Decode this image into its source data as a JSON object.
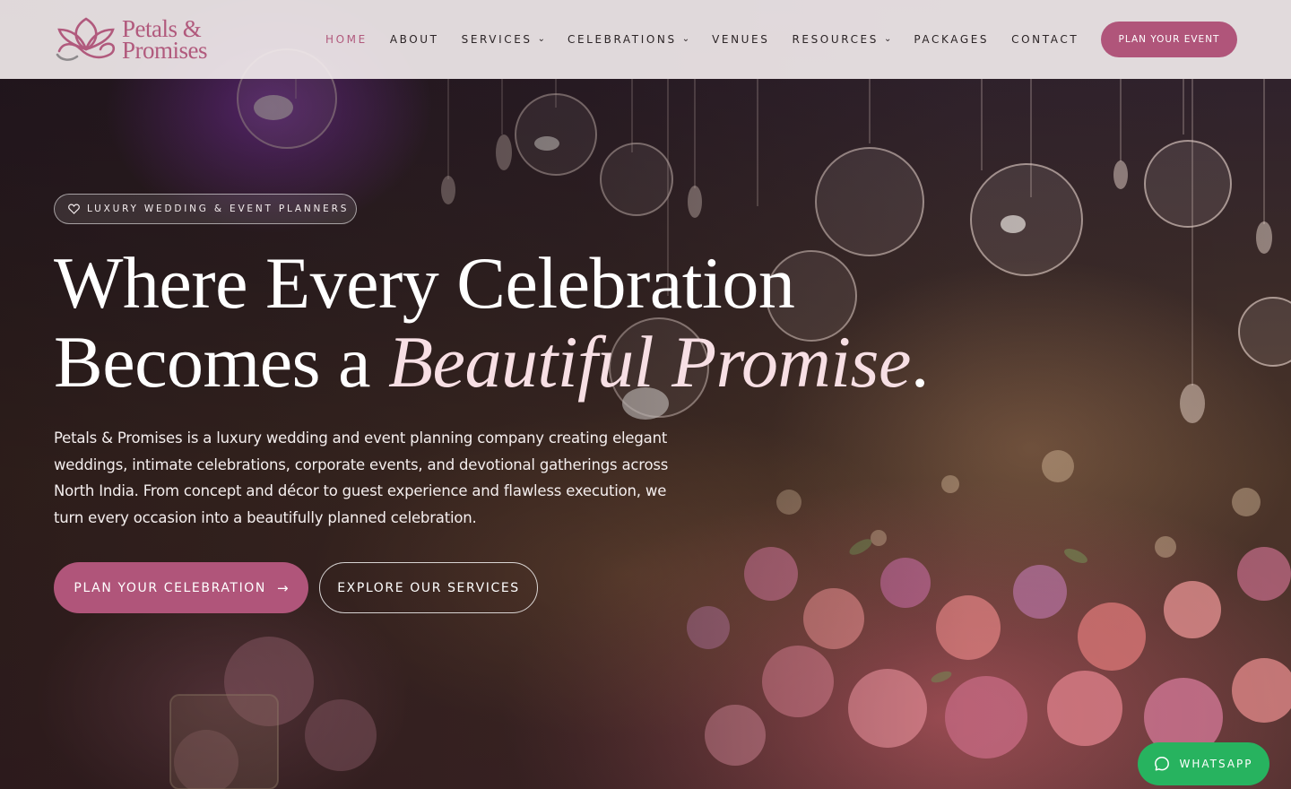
{
  "brand": {
    "name_line1": "Petals &",
    "name_line2": "Promises",
    "accent_color": "#b0557a"
  },
  "nav": {
    "items": [
      {
        "label": "HOME",
        "active": true,
        "dropdown": false
      },
      {
        "label": "ABOUT",
        "active": false,
        "dropdown": false
      },
      {
        "label": "SERVICES",
        "active": false,
        "dropdown": true
      },
      {
        "label": "CELEBRATIONS",
        "active": false,
        "dropdown": true
      },
      {
        "label": "VENUES",
        "active": false,
        "dropdown": false
      },
      {
        "label": "RESOURCES",
        "active": false,
        "dropdown": true
      },
      {
        "label": "PACKAGES",
        "active": false,
        "dropdown": false
      },
      {
        "label": "CONTACT",
        "active": false,
        "dropdown": false
      }
    ],
    "cta_label": "PLAN YOUR EVENT"
  },
  "hero": {
    "badge": "LUXURY WEDDING & EVENT PLANNERS",
    "headline_line1": "Where Every Celebration",
    "headline_line2_prefix": "Becomes a ",
    "headline_line2_emphasis": "Beautiful Promise",
    "headline_line2_suffix": ".",
    "lead": "Petals & Promises is a luxury wedding and event planning company creating elegant weddings, intimate celebrations, corporate events, and devotional gatherings across North India. From concept and décor to guest experience and flawless execution, we turn every occasion into a beautifully planned celebration.",
    "primary_cta": "PLAN YOUR CELEBRATION",
    "secondary_cta": "EXPLORE OUR SERVICES"
  },
  "whatsapp": {
    "label": "WHATSAPP",
    "color": "#27b35f"
  },
  "icons": {
    "logo": "lotus-logo-icon",
    "badge": "heart-icon",
    "dropdown": "chevron-down-icon",
    "cta_arrow": "arrow-right-icon",
    "whatsapp": "chat-bubble-icon"
  }
}
